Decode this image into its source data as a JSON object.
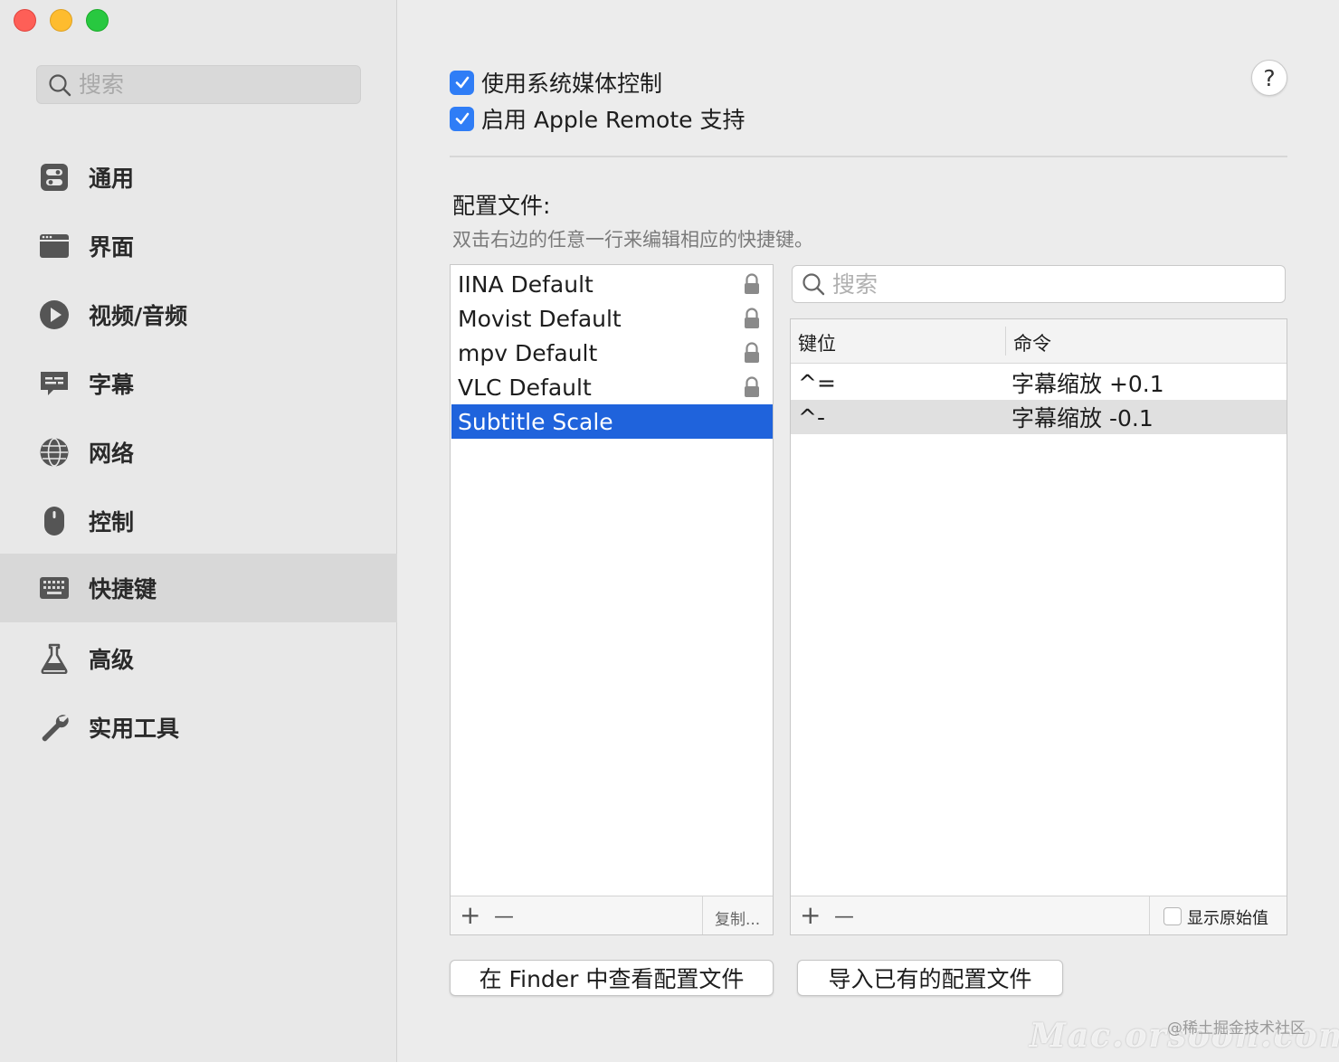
{
  "sidebar": {
    "search_placeholder": "搜索",
    "items": [
      {
        "label": "通用",
        "icon": "toggles-icon"
      },
      {
        "label": "界面",
        "icon": "window-icon"
      },
      {
        "label": "视频/音频",
        "icon": "play-circle-icon"
      },
      {
        "label": "字幕",
        "icon": "subtitle-bubble-icon"
      },
      {
        "label": "网络",
        "icon": "globe-icon"
      },
      {
        "label": "控制",
        "icon": "mouse-icon"
      },
      {
        "label": "快捷键",
        "icon": "keyboard-icon",
        "active": true
      },
      {
        "label": "高级",
        "icon": "flask-icon"
      },
      {
        "label": "实用工具",
        "icon": "wrench-icon"
      }
    ]
  },
  "options": {
    "system_media_control": {
      "label": "使用系统媒体控制",
      "checked": true
    },
    "apple_remote": {
      "label": "启用 Apple Remote 支持",
      "checked": true
    }
  },
  "help_label": "?",
  "config": {
    "title": "配置文件:",
    "description": "双击右边的任意一行来编辑相应的快捷键。",
    "profiles": [
      {
        "name": "IINA Default",
        "locked": true
      },
      {
        "name": "Movist Default",
        "locked": true
      },
      {
        "name": "mpv Default",
        "locked": true
      },
      {
        "name": "VLC Default",
        "locked": true
      },
      {
        "name": "Subtitle Scale",
        "locked": false,
        "selected": true
      }
    ],
    "add_label": "+",
    "remove_label": "—",
    "copy_label": "复制..."
  },
  "keys": {
    "search_placeholder": "搜索",
    "col_key": "键位",
    "col_command": "命令",
    "rows": [
      {
        "key": "^=",
        "command": "字幕缩放 +0.1"
      },
      {
        "key": "^-",
        "command": "字幕缩放 -0.1"
      }
    ],
    "add_label": "+",
    "remove_label": "—",
    "show_raw_label": "显示原始值",
    "show_raw_checked": false
  },
  "buttons": {
    "reveal_in_finder": "在 Finder 中查看配置文件",
    "import_config": "导入已有的配置文件"
  },
  "watermark": {
    "community": "@稀土掘金技术社区",
    "site": "Mac.orsoon.com"
  },
  "colors": {
    "accent": "#1f63dc",
    "checkbox": "#2f7df6"
  }
}
